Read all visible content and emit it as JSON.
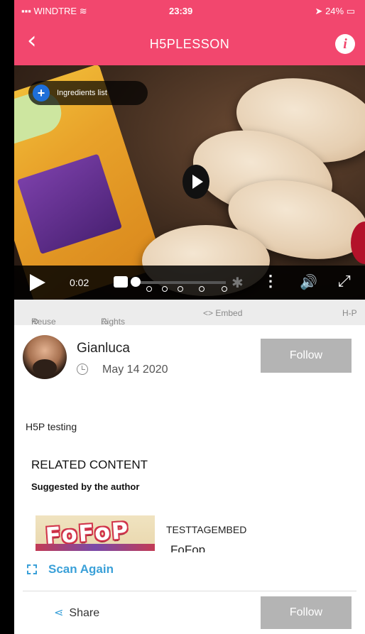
{
  "status_bar": {
    "carrier": "WINDTRE",
    "time": "23:39",
    "battery": "24%"
  },
  "nav": {
    "back_icon": "chevron-left",
    "title": "H5PLESSON",
    "info_label": "i"
  },
  "video": {
    "ingredients_label": "Ingredients list",
    "time": "0:02",
    "progress": 0.02
  },
  "h5p_bar": {
    "reuse": "Reuse",
    "rights": "Rights of use",
    "embed": "<> Embed",
    "h5p": "H-P"
  },
  "author": {
    "name": "Gianluca",
    "date": "May 14 2020",
    "follow_label": "Follow"
  },
  "description": "H5P testing",
  "related": {
    "heading": "RELATED CONTENT",
    "subheading": "Suggested by the author",
    "items": [
      {
        "thumb_text": "FoFoP",
        "title": "TESTTAGEMBED",
        "subtitle": "FoFop"
      }
    ]
  },
  "scan_again_label": "Scan Again",
  "bottom": {
    "share_label": "Share",
    "follow_label": "Follow"
  },
  "colors": {
    "brand": "#f2476e",
    "link": "#3aa0d8",
    "button": "#b4b4b4"
  }
}
